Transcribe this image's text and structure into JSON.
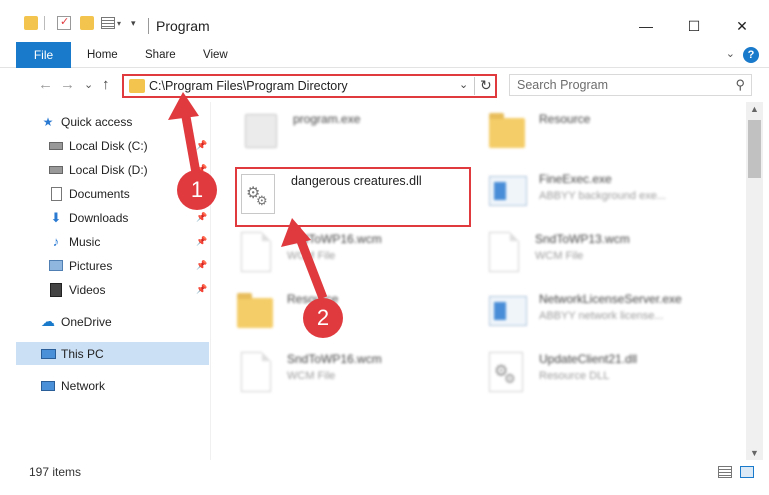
{
  "window": {
    "title": "Program",
    "minimize": "—",
    "maximize": "☐",
    "close": "✕"
  },
  "ribbon": {
    "tabs": [
      "File",
      "Home",
      "Share",
      "View"
    ],
    "help": "?"
  },
  "nav": {
    "back": "←",
    "forward": "→",
    "recent": "⌄",
    "up": "↑",
    "address": "C:\\Program Files\\Program Directory",
    "search_placeholder": "Search Program"
  },
  "sidebar": {
    "items": [
      {
        "label": "Quick access",
        "icon": "star-icon",
        "pinned": false
      },
      {
        "label": "Local Disk (C:)",
        "icon": "drive-icon",
        "pinned": true
      },
      {
        "label": "Local Disk (D:)",
        "icon": "drive-icon",
        "pinned": true
      },
      {
        "label": "Documents",
        "icon": "document-icon",
        "pinned": true
      },
      {
        "label": "Downloads",
        "icon": "download-icon",
        "pinned": true
      },
      {
        "label": "Music",
        "icon": "music-icon",
        "pinned": true
      },
      {
        "label": "Pictures",
        "icon": "pictures-icon",
        "pinned": true
      },
      {
        "label": "Videos",
        "icon": "videos-icon",
        "pinned": true
      },
      {
        "label": "OneDrive",
        "icon": "cloud-icon",
        "pinned": false
      },
      {
        "label": "This PC",
        "icon": "computer-icon",
        "pinned": false,
        "selected": true
      },
      {
        "label": "Network",
        "icon": "network-icon",
        "pinned": false
      }
    ]
  },
  "files": [
    {
      "name": "program.exe",
      "desc": "",
      "icon": "exe-icon",
      "blurred": true
    },
    {
      "name": "Resource",
      "desc": "",
      "icon": "folder-icon",
      "blurred": true
    },
    {
      "name": "dangerous creatures.dll",
      "desc": "",
      "icon": "gear-file-icon",
      "blurred": false
    },
    {
      "name": "FineExec.exe",
      "desc": "ABBYY background exe...",
      "icon": "app-icon",
      "blurred": true
    },
    {
      "name": "SndToWP16.wcm",
      "desc": "WCM File",
      "icon": "document-icon",
      "blurred": true
    },
    {
      "name": "SndToWP13.wcm",
      "desc": "WCM File",
      "icon": "document-icon",
      "blurred": true
    },
    {
      "name": "Resource",
      "desc": "",
      "icon": "folder-icon",
      "blurred": true
    },
    {
      "name": "NetworkLicenseServer.exe",
      "desc": "ABBYY network license...",
      "icon": "app-icon",
      "blurred": true
    },
    {
      "name": "SndToWP16.wcm",
      "desc": "WCM File",
      "icon": "document-icon",
      "blurred": true
    },
    {
      "name": "UpdateClient21.dll",
      "desc": "Resource DLL",
      "icon": "gear-file-icon",
      "blurred": true
    }
  ],
  "annotations": {
    "badge1": "1",
    "badge2": "2"
  },
  "status": {
    "item_count": "197 items"
  },
  "colors": {
    "accent": "#1979ca",
    "highlight": "#e0393e",
    "selection": "#cce0f5"
  }
}
